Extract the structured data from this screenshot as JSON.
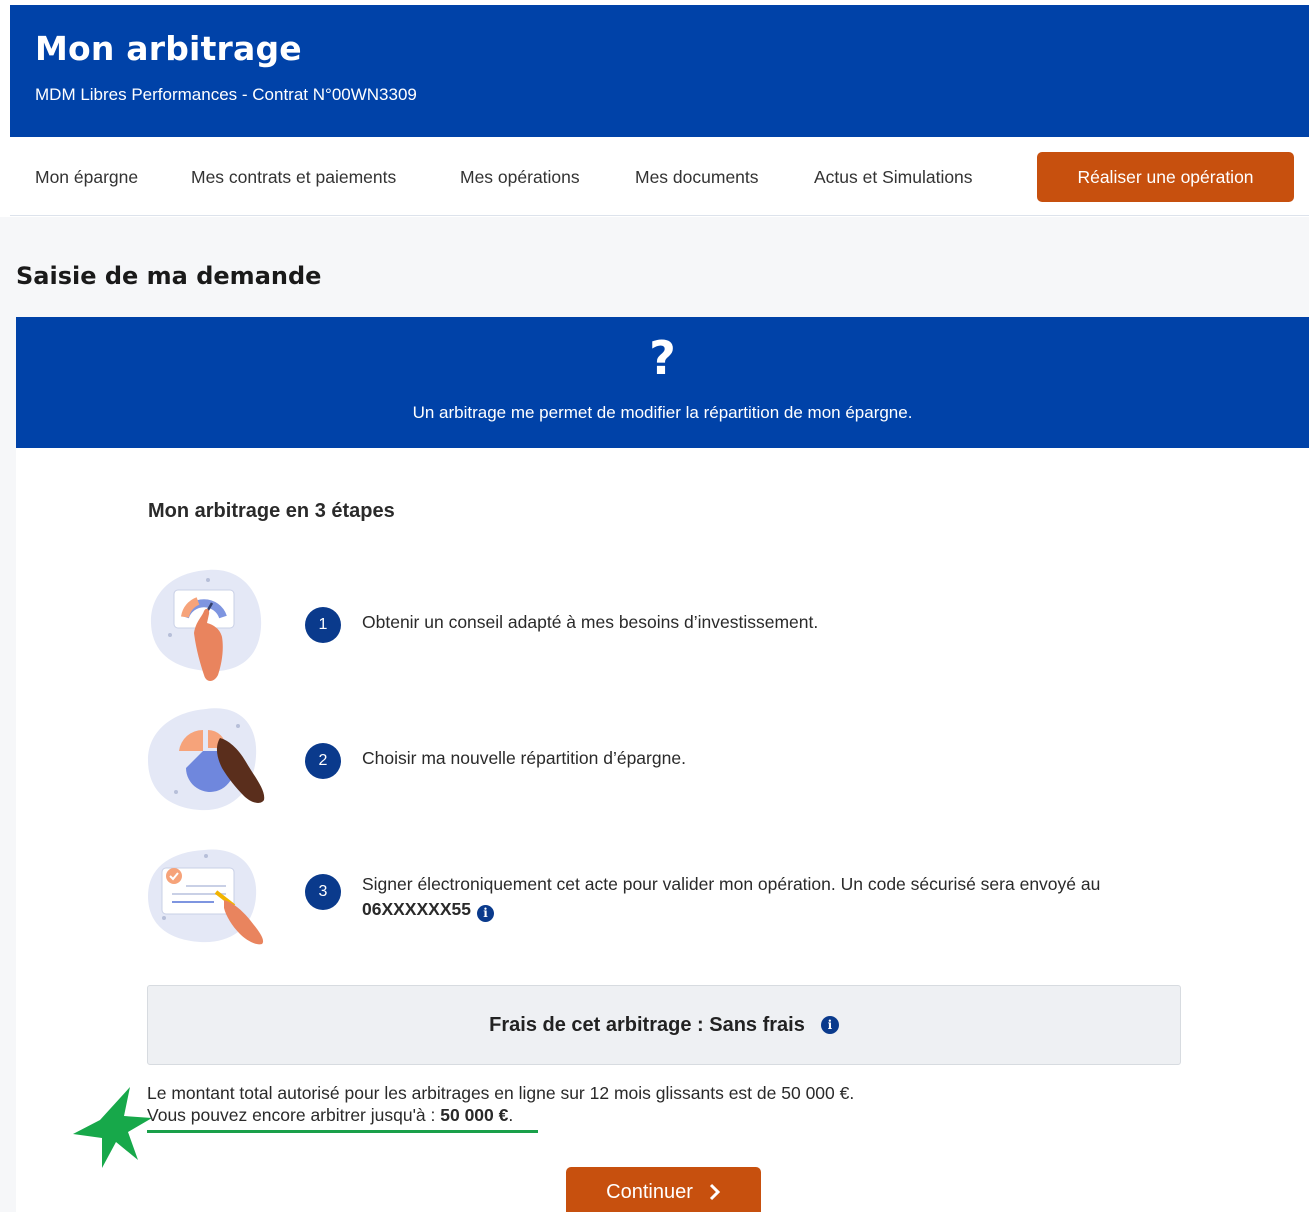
{
  "header": {
    "title": "Mon arbitrage",
    "subtitle": "MDM Libres Performances - Contrat N°00WN3309"
  },
  "nav": {
    "items": [
      {
        "label": "Mon épargne"
      },
      {
        "label": "Mes contrats et paiements"
      },
      {
        "label": "Mes opérations"
      },
      {
        "label": "Mes documents"
      },
      {
        "label": "Actus et Simulations"
      }
    ],
    "cta_label": "Réaliser une opération"
  },
  "page": {
    "title": "Saisie de ma demande"
  },
  "banner": {
    "icon": "?",
    "text": "Un arbitrage me permet de modifier la répartition de mon épargne."
  },
  "steps": {
    "title": "Mon arbitrage en 3 étapes",
    "items": [
      {
        "number": "1",
        "text": "Obtenir un conseil adapté à mes besoins d’investissement."
      },
      {
        "number": "2",
        "text": "Choisir ma nouvelle répartition d’épargne."
      },
      {
        "number": "3",
        "text": "Signer électroniquement cet acte pour valider mon opération. Un code sécurisé sera envoyé au",
        "phone": "06XXXXXX55"
      }
    ]
  },
  "fees": {
    "text": "Frais de cet arbitrage : Sans frais"
  },
  "limit": {
    "line1": "Le montant total autorisé pour les arbitrages en ligne sur 12 mois glissants est de 50 000 €.",
    "line2_prefix": "Vous pouvez encore arbitrer jusqu'à : ",
    "line2_amount": "50 000 €",
    "line2_suffix": "."
  },
  "continue_label": "Continuer",
  "colors": {
    "brand_blue": "#0042a8",
    "step_blue": "#0a3a8c",
    "cta_orange": "#c7500e",
    "annotation_green": "#1aa04a"
  },
  "icons": {
    "info": "info-icon",
    "chevron": "chevron-right-icon",
    "annotation": "star-icon"
  }
}
